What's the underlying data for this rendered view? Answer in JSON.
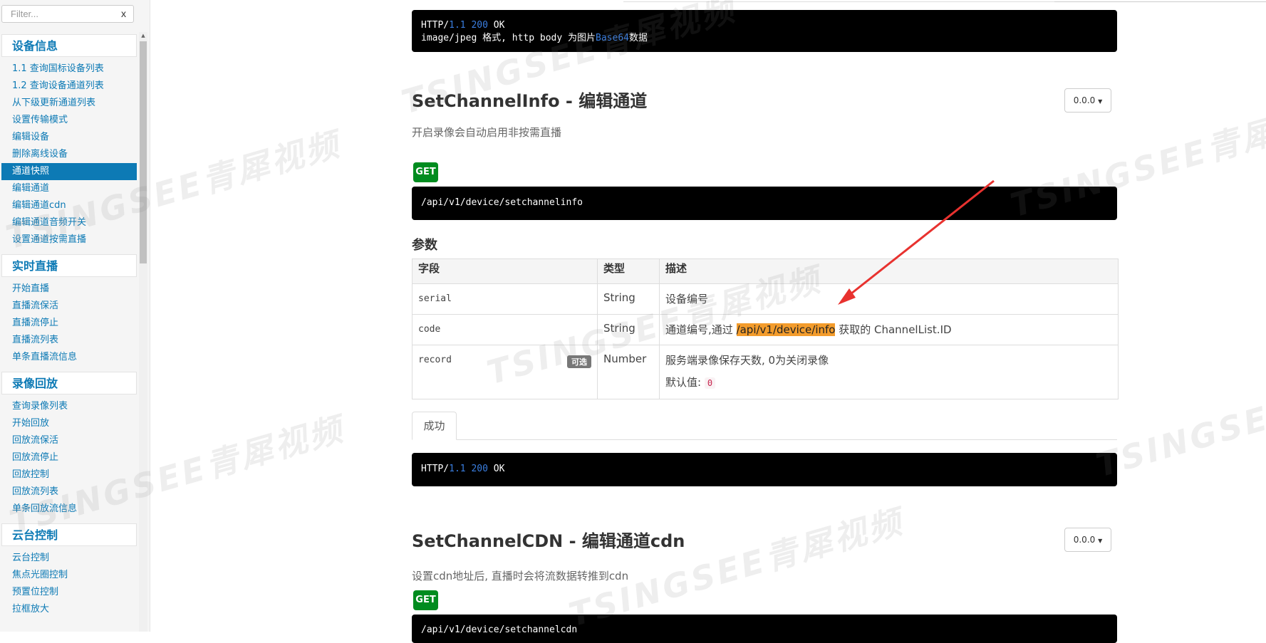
{
  "sidebar": {
    "filter": {
      "placeholder": "Filter...",
      "clear_label": "x"
    },
    "groups": [
      {
        "title": "设备信息",
        "items": [
          {
            "label": "1.1 查询国标设备列表"
          },
          {
            "label": "1.2 查询设备通道列表"
          },
          {
            "label": "从下级更新通道列表"
          },
          {
            "label": "设置传输模式"
          },
          {
            "label": "编辑设备"
          },
          {
            "label": "删除离线设备"
          },
          {
            "label": "通道快照"
          },
          {
            "label": "编辑通道"
          },
          {
            "label": "编辑通道cdn"
          },
          {
            "label": "编辑通道音频开关"
          },
          {
            "label": "设置通道按需直播"
          }
        ]
      },
      {
        "title": "实时直播",
        "items": [
          {
            "label": "开始直播"
          },
          {
            "label": "直播流保活"
          },
          {
            "label": "直播流停止"
          },
          {
            "label": "直播流列表"
          },
          {
            "label": "单条直播流信息"
          }
        ]
      },
      {
        "title": "录像回放",
        "items": [
          {
            "label": "查询录像列表"
          },
          {
            "label": "开始回放"
          },
          {
            "label": "回放流保活"
          },
          {
            "label": "回放流停止"
          },
          {
            "label": "回放控制"
          },
          {
            "label": "回放流列表"
          },
          {
            "label": "单条回放流信息"
          }
        ]
      },
      {
        "title": "云台控制",
        "items": [
          {
            "label": "云台控制"
          },
          {
            "label": "焦点光圈控制"
          },
          {
            "label": "预置位控制"
          },
          {
            "label": "拉框放大"
          }
        ]
      }
    ],
    "active_item": "通道快照"
  },
  "top_response": {
    "line1_prefix": "HTTP/",
    "line1_version": "1.1",
    "line1_code": "200",
    "line1_status": "OK",
    "line2_prefix": "image/jpeg 格式, http body 为图片",
    "line2_kw": "Base64",
    "line2_suffix": "数据"
  },
  "section1": {
    "title": "SetChannelInfo - 编辑通道",
    "version": "0.0.0",
    "description": "开启录像会自动启用非按需直播",
    "method": "GET",
    "endpoint": "/api/v1/device/setchannelinfo",
    "params_title": "参数",
    "table": {
      "headers": {
        "field": "字段",
        "type": "类型",
        "desc": "描述"
      },
      "rows": [
        {
          "field": "serial",
          "type": "String",
          "desc": "设备编号"
        },
        {
          "field": "code",
          "type": "String",
          "desc_prefix": "通道编号,通过 ",
          "desc_highlight": "/api/v1/device/info",
          "desc_suffix": " 获取的 ChannelList.ID"
        },
        {
          "field": "record",
          "optional": "可选",
          "type": "Number",
          "desc": "服务端录像保存天数, 0为关闭录像",
          "default_label": "默认值:",
          "default_value": "0"
        }
      ]
    },
    "tab_label": "成功",
    "response": {
      "prefix": "HTTP/",
      "version": "1.1",
      "code": "200",
      "status": "OK"
    }
  },
  "section2": {
    "title": "SetChannelCDN - 编辑通道cdn",
    "version": "0.0.0",
    "description": "设置cdn地址后, 直播时会将流数据转推到cdn",
    "method": "GET",
    "endpoint": "/api/v1/device/setchannelcdn"
  },
  "watermark": "TSINGSEE青犀视频",
  "colors": {
    "accent": "#0d7ab5",
    "get_badge": "#008c1f",
    "highlight": "#f39c2c",
    "arrow": "#e8322f"
  }
}
